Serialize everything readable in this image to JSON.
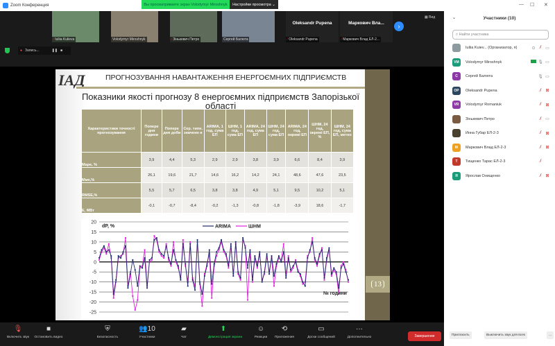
{
  "window": {
    "title": "Zoom Конференция",
    "share_banner": "Вы просматриваете экран Volodymyr Miroshnyk",
    "view_options": "Настройки просмотра ⌄",
    "view_label": "Вид",
    "recording": "Запись..."
  },
  "video_tiles": [
    {
      "name": "Iuliia Kulieva",
      "muted": true,
      "color": "#6b8a6a"
    },
    {
      "name": "Volodymyr Miroshnyk",
      "muted": false,
      "color": "#8a8070"
    },
    {
      "name": "Зінькевич Петро",
      "muted": true,
      "color": "#5e6a5a"
    },
    {
      "name": "Сергей Балюта",
      "muted": false,
      "color": "#7a8593"
    },
    {
      "name": "Oleksandr Pupena",
      "big": "Oleksandr Pupena",
      "muted": true,
      "color": "#222"
    },
    {
      "name": "Маркович Влад ЕЛ-2...",
      "big": "Маркович  Вла...",
      "muted": true,
      "color": "#222"
    }
  ],
  "slide": {
    "logo": "ІАД",
    "header": "ПРОГНОЗУВАННЯ НАВАНТАЖЕННЯ ЕНЕРГОЄМНИХ ПІДПРИЄМСТВ",
    "subtitle": "Показники якості прогнозу 8 енергоємних підприємств Запорізької області",
    "page_number": "13",
    "table": {
      "columns": [
        "Характеристики точності прогнозування",
        "Попере дня години",
        "Попере дня доби",
        "Сер. типн. значенн я",
        "ARIMA, 1 год, сума ЕП",
        "ШНМ, 1 год, сума ЕП",
        "ARIMA, 24 год, сума ЕП",
        "ШНМ, 24 год, сума ЕП",
        "ARIMA, 24 год, окремі ЕП",
        "ШНМ, 24 год, окремі ЕП, %",
        "ШНМ, 24 год, сума ЕП, метео"
      ],
      "rows": [
        {
          "label": "Mape, %",
          "values": [
            "3,9",
            "4,4",
            "5,3",
            "2,9",
            "2,9",
            "3,8",
            "3,9",
            "6,6",
            "8,4",
            "3,9"
          ]
        },
        {
          "label": "Mмх,%",
          "values": [
            "26,1",
            "19,6",
            "21,7",
            "14,6",
            "16,2",
            "14,2",
            "24,1",
            "48,6",
            "47,6",
            "23,5"
          ]
        },
        {
          "label": "RMSE,%",
          "values": [
            "5,5",
            "5,7",
            "6,5",
            "3,8",
            "3,8",
            "4,9",
            "5,1",
            "9,5",
            "10,2",
            "5,1"
          ]
        },
        {
          "label": "Е, МВт",
          "values": [
            "-0,1",
            "-0,7",
            "-8,4",
            "-0,2",
            "-1,3",
            "-0,8",
            "-1,8",
            "-3,9",
            "18,6",
            "-1,7"
          ]
        }
      ]
    }
  },
  "chart_data": {
    "type": "line",
    "ylabel": "dP, %",
    "xlabel": "№ години",
    "ylim": [
      -25,
      20
    ],
    "yticks": [
      20,
      15,
      10,
      5,
      0,
      -5,
      -10,
      -15,
      -20,
      -25
    ],
    "grid": true,
    "legend": "top-center",
    "series": [
      {
        "name": "ARIMA",
        "color": "#1f2a6b",
        "values": [
          2,
          6,
          8,
          5,
          6,
          3,
          -16,
          -9,
          3,
          2,
          5,
          8,
          -13,
          -6,
          1,
          -4,
          -12,
          -2,
          -3,
          2,
          -13,
          1,
          2,
          11,
          12,
          6,
          4,
          3,
          8,
          2,
          -1,
          6,
          1,
          -2,
          -9,
          9,
          -1,
          -12,
          9,
          -9,
          -14,
          11,
          -10,
          -16,
          -7,
          -2,
          6,
          -11,
          -1,
          5,
          7,
          11,
          6,
          4,
          -2,
          9,
          -7,
          10,
          -5,
          -8,
          12,
          7,
          -3,
          6,
          -9,
          3,
          -2,
          5,
          -10,
          -5,
          4,
          -6,
          3,
          -7,
          -1,
          3,
          0,
          5,
          -8,
          2,
          -4,
          -2,
          0,
          -5,
          -6,
          -10,
          -12,
          2,
          6,
          10,
          2,
          -1,
          4,
          6,
          -8,
          2,
          7,
          -6,
          -3,
          -5,
          -13,
          -3,
          -1,
          -5,
          -9
        ]
      },
      {
        "name": "ШНМ",
        "color": "#e020e0",
        "values": [
          1,
          5,
          7,
          4,
          9,
          2,
          -18,
          -10,
          2,
          3,
          4,
          12,
          -12,
          -5,
          -17,
          -24,
          -19,
          -3,
          -2,
          6,
          -12,
          0,
          1,
          13,
          11,
          5,
          3,
          2,
          9,
          1,
          -2,
          10,
          0,
          -3,
          -8,
          11,
          -2,
          -10,
          10,
          -8,
          -12,
          10,
          -11,
          -22,
          -6,
          -1,
          4,
          -18,
          -2,
          3,
          6,
          10,
          5,
          3,
          -3,
          8,
          -6,
          9,
          -6,
          -9,
          11,
          8,
          -19,
          5,
          -10,
          2,
          -3,
          4,
          -9,
          -6,
          3,
          -5,
          2,
          -12,
          -2,
          2,
          1,
          9,
          -7,
          3,
          -5,
          -3,
          1,
          -4,
          -7,
          -11,
          -10,
          3,
          5,
          12,
          1,
          -2,
          3,
          7,
          -9,
          1,
          6,
          -7,
          -4,
          -6,
          -16,
          -2,
          0,
          -4,
          -10
        ]
      }
    ]
  },
  "participants": {
    "title": "Участники (10)",
    "search_placeholder": "Найти участника",
    "items": [
      {
        "initials": "",
        "name": "Iuliia Kuiev... (Организатор, я)",
        "color": "#8d9aa0",
        "mic": "muted",
        "video": "off-plain",
        "extra": "⊙"
      },
      {
        "initials": "VM",
        "name": "Volodymyr Miroshnyk",
        "color": "#1a9c7a",
        "mic": "on",
        "video": "off-plain",
        "extra": "share"
      },
      {
        "initials": "C",
        "name": "Сергей Балюта",
        "color": "#8e3aa6",
        "mic": "on",
        "video": "off-plain"
      },
      {
        "initials": "OP",
        "name": "Oleksandr Pupena",
        "color": "#2c4660",
        "mic": "muted",
        "video": "muted"
      },
      {
        "initials": "VR",
        "name": "Volodymyr Romaniuk",
        "color": "#8e3aa6",
        "mic": "muted",
        "video": "muted"
      },
      {
        "initials": "",
        "name": "Зінькевич Петро",
        "color": "#7a5a40",
        "mic": "muted",
        "video": "off-plain"
      },
      {
        "initials": "",
        "name": "Инна Губар ЕЛ-2-3",
        "color": "#4a4030",
        "mic": "muted",
        "video": "muted"
      },
      {
        "initials": "M",
        "name": "Маркович Влад ЕЛ-2-3",
        "color": "#f0a020",
        "mic": "muted",
        "video": "muted"
      },
      {
        "initials": "T",
        "name": "Тищенко Тарас ЕЛ-2-3",
        "color": "#c0392b",
        "mic": "muted",
        "video": "none"
      },
      {
        "initials": "Я",
        "name": "Ярослав Онищенко",
        "color": "#1a9c7a",
        "mic": "muted",
        "video": "muted"
      }
    ],
    "invite": "Пригласить",
    "mute_all": "Выключить звук для всех",
    "more": "..."
  },
  "toolbar": {
    "items": [
      {
        "id": "unmute",
        "label": "Включить звук",
        "icon": "mic-muted-icon",
        "glyph": "🎙"
      },
      {
        "id": "video",
        "label": "Остановить видео",
        "icon": "video-icon",
        "glyph": "■"
      },
      {
        "id": "security",
        "label": "Безопасность",
        "icon": "shield-icon",
        "glyph": "⛨"
      },
      {
        "id": "participants",
        "label": "Участники",
        "icon": "participants-icon",
        "glyph": "👥10"
      },
      {
        "id": "chat",
        "label": "Чат",
        "icon": "chat-icon",
        "glyph": "▰"
      },
      {
        "id": "share",
        "label": "Демонстрация экрана",
        "icon": "share-screen-icon",
        "glyph": "⬆"
      },
      {
        "id": "reactions",
        "label": "Реакции",
        "icon": "reactions-icon",
        "glyph": "☺"
      },
      {
        "id": "apps",
        "label": "Приложения",
        "icon": "apps-icon",
        "glyph": "⟲"
      },
      {
        "id": "whiteboard",
        "label": "Доски сообщений",
        "icon": "whiteboard-icon",
        "glyph": "▭"
      },
      {
        "id": "more",
        "label": "Дополнительно",
        "icon": "more-icon",
        "glyph": "···"
      }
    ],
    "end": "Завершение",
    "accent": "#23d959"
  }
}
